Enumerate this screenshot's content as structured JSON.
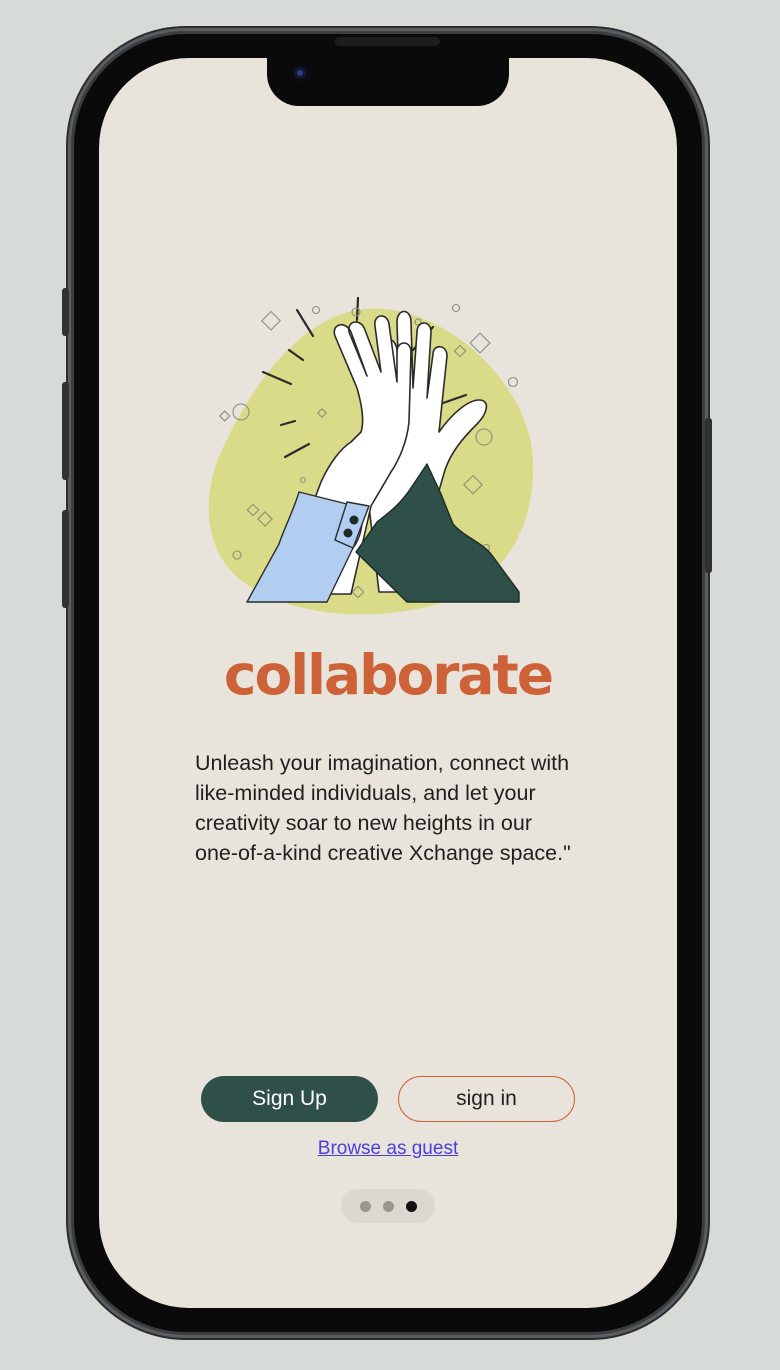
{
  "onboarding": {
    "title": "collaborate",
    "description": "Unleash your imagination, connect with like-minded individuals, and let your creativity soar to new heights in our one-of-a-kind creative Xchange space.\"",
    "sign_up_label": "Sign Up",
    "sign_in_label": "sign in",
    "guest_label": "Browse as guest",
    "page_indicator": {
      "total": 3,
      "active_index": 2
    }
  },
  "illustration": {
    "name": "high-five-illustration"
  },
  "colors": {
    "background": "#e8e4db",
    "accent": "#cd6138",
    "primary_button": "#2f5048",
    "link": "#4a3fdc",
    "blob": "#dadb88",
    "left_sleeve": "#b1cef0",
    "right_sleeve": "#2f5048"
  }
}
